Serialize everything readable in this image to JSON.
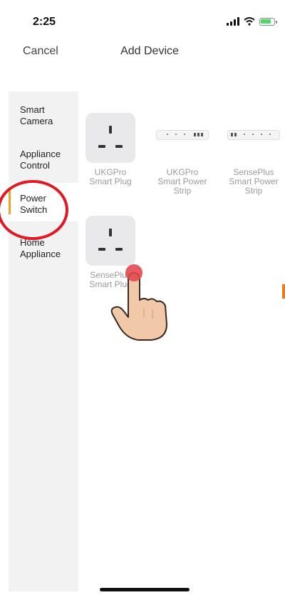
{
  "status": {
    "time": "2:25"
  },
  "nav": {
    "cancel_label": "Cancel",
    "title": "Add Device"
  },
  "sidebar": {
    "items": [
      {
        "label_line1": "Smart",
        "label_line2": "Camera"
      },
      {
        "label_line1": "Appliance",
        "label_line2": "Control"
      },
      {
        "label_line1": "Power",
        "label_line2": "Switch"
      },
      {
        "label_line1": "Home",
        "label_line2": "Appliance"
      }
    ],
    "selected": "Power Switch"
  },
  "products": [
    {
      "line1": "UKGPro",
      "line2": "Smart Plug",
      "icon": "plug-icon"
    },
    {
      "line1": "UKGPro",
      "line2": "Smart Power",
      "line3": "Strip",
      "icon": "power-strip-icon"
    },
    {
      "line1": "SensePlus",
      "line2": "Smart Power",
      "line3": "Strip",
      "icon": "power-strip-icon"
    },
    {
      "line1": "SensePlus",
      "line2": "Smart Plug",
      "icon": "plug-icon"
    }
  ],
  "colors": {
    "accent": "#f0a030",
    "annotation": "#e01a22",
    "sidebar_bg": "#f2f2f2"
  }
}
